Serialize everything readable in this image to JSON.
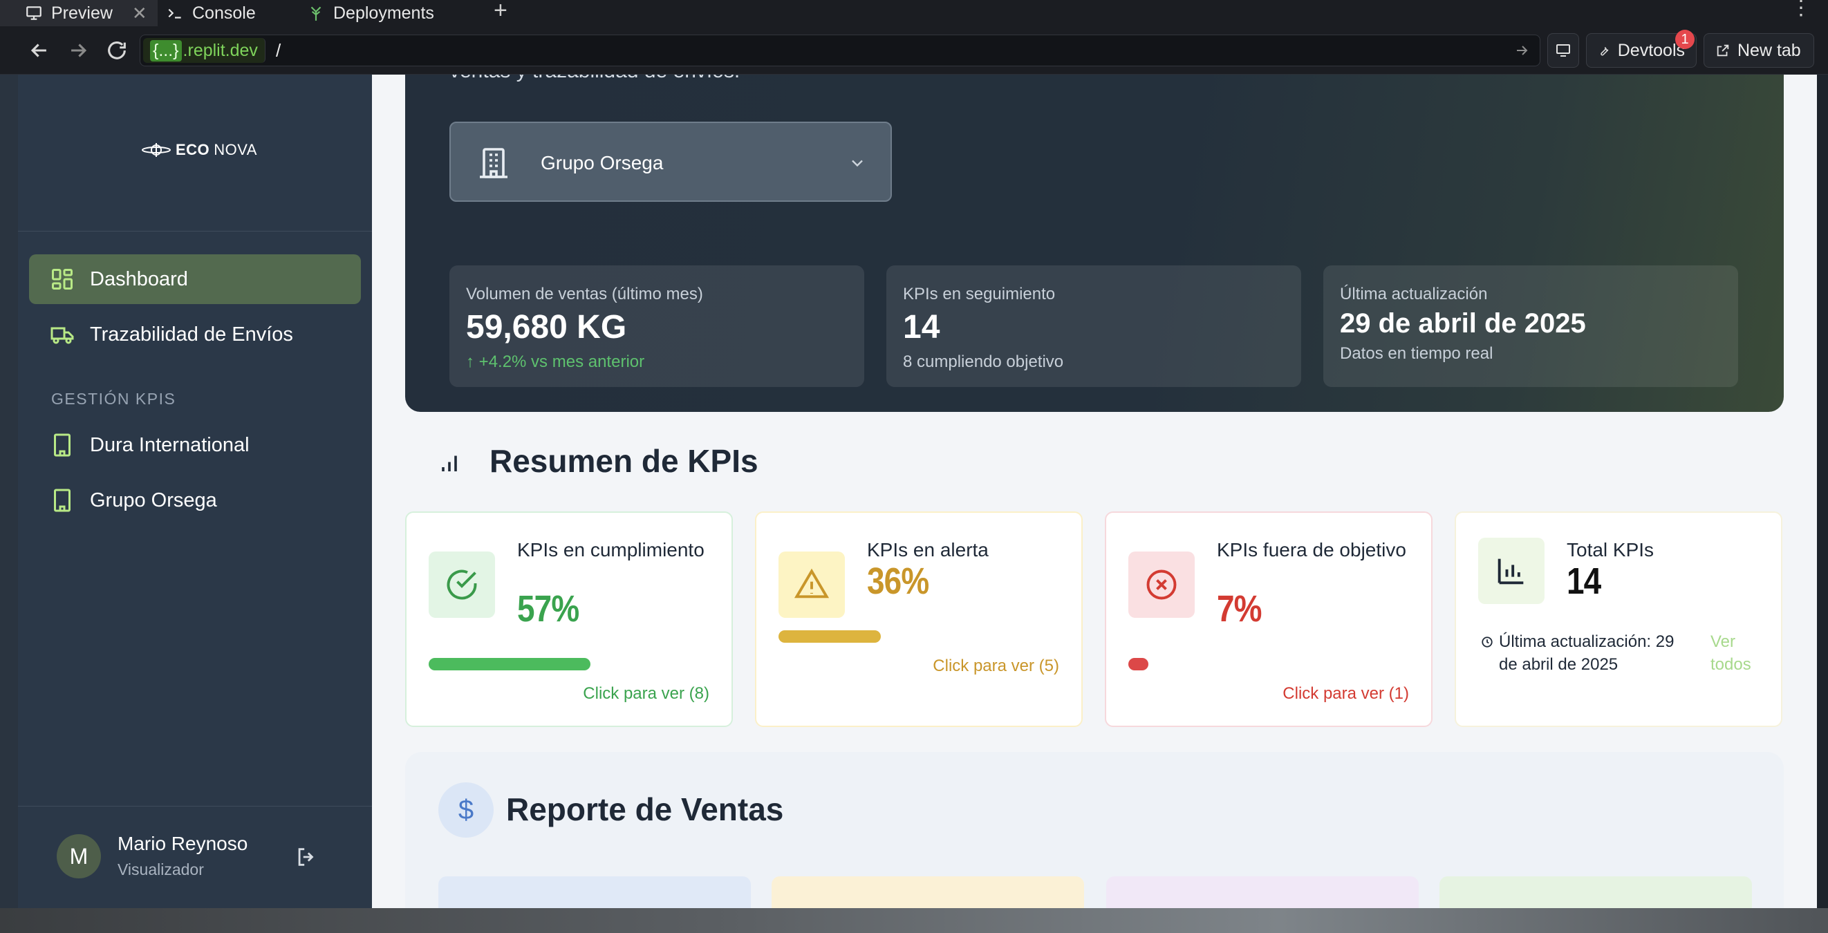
{
  "browser": {
    "tabs": [
      {
        "label": "Preview",
        "active": true
      },
      {
        "label": "Console",
        "active": false
      },
      {
        "label": "Deployments",
        "active": false
      }
    ],
    "url_host_prefix": "{...}",
    "url_host_suffix": ".replit.dev",
    "url_path": "/",
    "devtools_label": "Devtools",
    "devtools_badge": "1",
    "new_tab_label": "New tab"
  },
  "sidebar": {
    "logo_bold": "ECO",
    "logo_light": "NOVA",
    "nav": [
      {
        "label": "Dashboard",
        "active": true
      },
      {
        "label": "Trazabilidad de Envíos",
        "active": false
      }
    ],
    "section_label": "GESTIÓN KPIS",
    "kpi_companies": [
      "Dura International",
      "Grupo Orsega"
    ],
    "user": {
      "initial": "M",
      "name": "Mario Reynoso",
      "role": "Visualizador"
    }
  },
  "hero": {
    "subtitle": "ventas y trazabilidad de envíos.",
    "selected_company": "Grupo Orsega",
    "stats": [
      {
        "label": "Volumen de ventas (último mes)",
        "value": "59,680 KG",
        "sub": "+4.2% vs mes anterior"
      },
      {
        "label": "KPIs en seguimiento",
        "value": "14",
        "sub": "8 cumpliendo objetivo"
      },
      {
        "label": "Última actualización",
        "value": "29 de abril de 2025",
        "sub": "Datos en tiempo real"
      }
    ]
  },
  "kpi_summary": {
    "title": "Resumen de KPIs",
    "cards": [
      {
        "title": "KPIs en cumplimiento",
        "value": "57%",
        "progress": 0.57,
        "link": "Click para ver (8)",
        "color": "#3aa34e"
      },
      {
        "title": "KPIs en alerta",
        "value": "36%",
        "progress": 0.36,
        "link": "Click para ver (5)",
        "color": "#c9962a"
      },
      {
        "title": "KPIs fuera de objetivo",
        "value": "7%",
        "progress": 0.07,
        "link": "Click para ver (1)",
        "color": "#d33b32"
      },
      {
        "title": "Total KPIs",
        "value": "14",
        "foot": "Última actualización: 29 de abril de 2025",
        "link": "Ver todos",
        "color": "#111111"
      }
    ]
  },
  "sales_report": {
    "title": "Reporte de Ventas"
  }
}
